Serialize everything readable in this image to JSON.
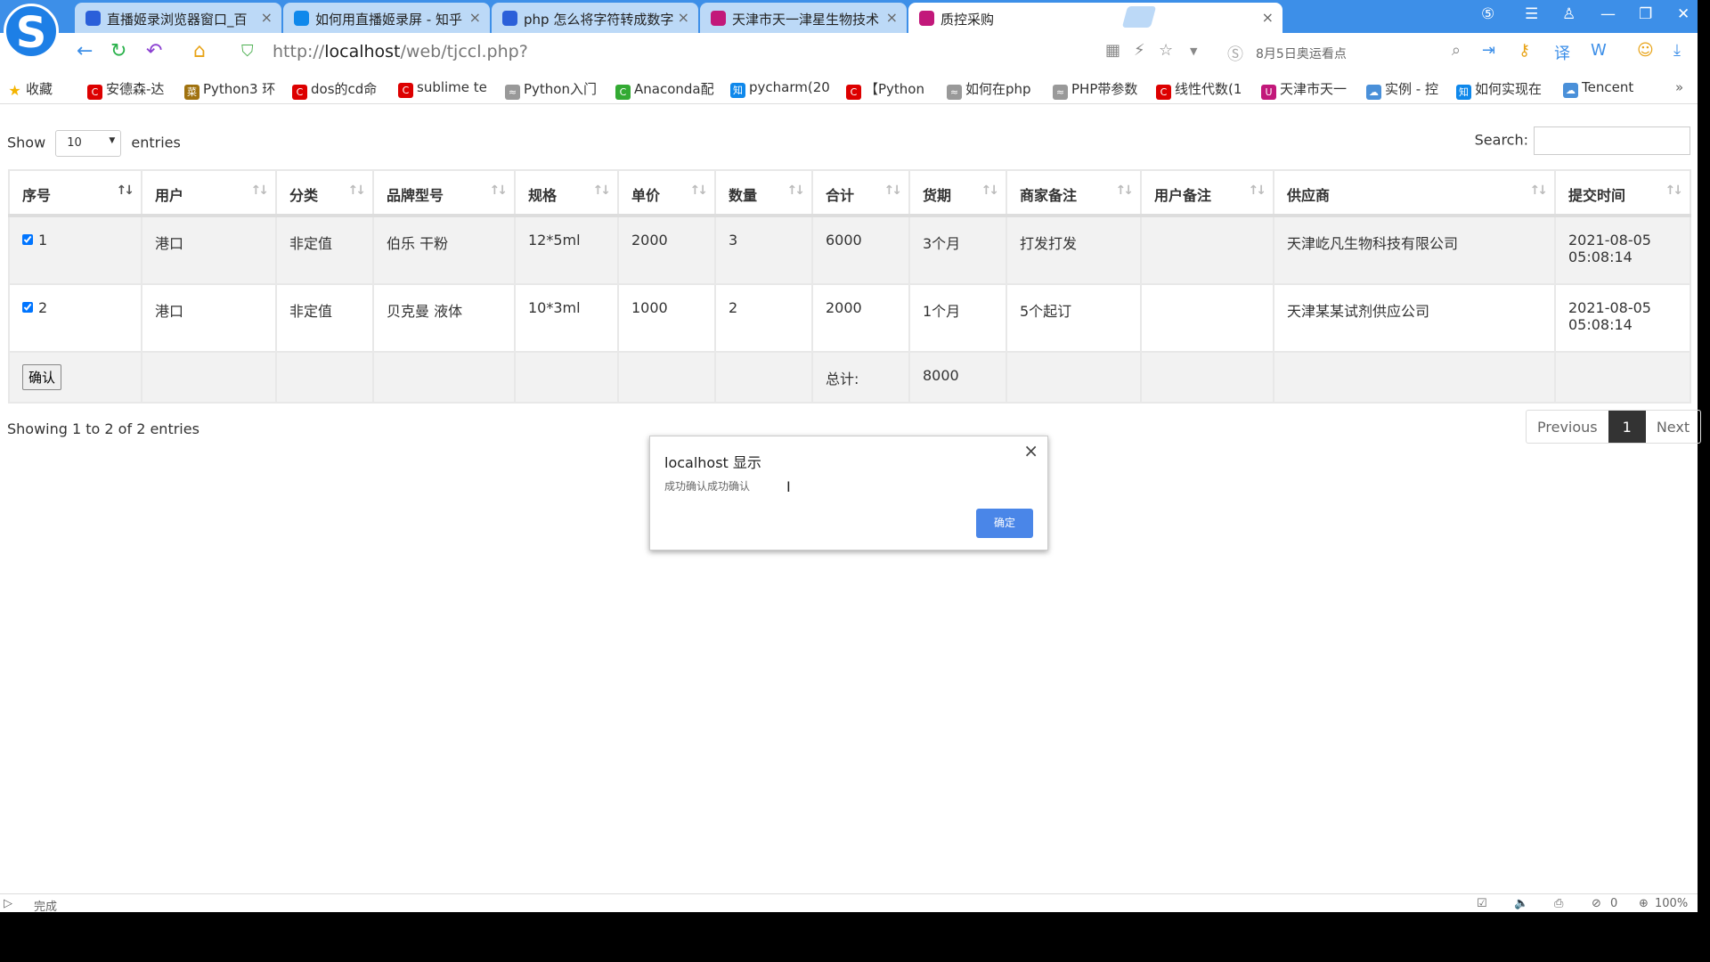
{
  "browser": {
    "tabs": [
      {
        "label": "直播姬录浏览器窗口_百",
        "icon": "baidu-paw-icon",
        "color": "#2b5fd9"
      },
      {
        "label": "如何用直播姬录屏 - 知乎",
        "icon": "zhihu-icon",
        "color": "#0f88eb"
      },
      {
        "label": "php 怎么将字符转成数字",
        "icon": "baidu-paw-icon",
        "color": "#2b5fd9"
      },
      {
        "label": "天津市天一津星生物技术",
        "icon": "site-icon",
        "color": "#c2187a"
      },
      {
        "label": "质控采购",
        "icon": "site-icon",
        "color": "#c2187a",
        "active": true
      }
    ],
    "url_prefix": "http://",
    "url_host": "localhost",
    "url_path": "/web/tjccl.php?",
    "search_hint": "8月5日奥运看点",
    "bookmarks": [
      {
        "label": "收藏",
        "color": "#f4b400",
        "glyph": "★"
      },
      {
        "label": "安德森-达",
        "color": "#d00",
        "glyph": "C"
      },
      {
        "label": "Python3 环",
        "color": "#a0720f",
        "glyph": "菜"
      },
      {
        "label": "dos的cd命",
        "color": "#d00",
        "glyph": "C"
      },
      {
        "label": "sublime te",
        "color": "#d00",
        "glyph": "C"
      },
      {
        "label": "Python入门",
        "color": "#999",
        "glyph": "≈"
      },
      {
        "label": "Anaconda配",
        "color": "#3a3",
        "glyph": "C"
      },
      {
        "label": "pycharm(20",
        "color": "#0f88eb",
        "glyph": "知"
      },
      {
        "label": "【Python",
        "color": "#d00",
        "glyph": "C"
      },
      {
        "label": "如何在php",
        "color": "#999",
        "glyph": "≈"
      },
      {
        "label": "PHP带参数",
        "color": "#999",
        "glyph": "≈"
      },
      {
        "label": "线性代数(1",
        "color": "#d00",
        "glyph": "C"
      },
      {
        "label": "天津市天一",
        "color": "#c2187a",
        "glyph": "U"
      },
      {
        "label": "实例 - 控",
        "color": "#4a90d9",
        "glyph": "☁"
      },
      {
        "label": "如何实现在",
        "color": "#0f88eb",
        "glyph": "知"
      },
      {
        "label": "Tencent",
        "color": "#4a90d9",
        "glyph": "☁"
      }
    ],
    "status_left": "完成",
    "status_count": "0",
    "zoom": "100%"
  },
  "page": {
    "show_label": "Show",
    "entries_label": "entries",
    "page_length": "10",
    "search_label": "Search:",
    "search_value": "",
    "columns": [
      "序号",
      "用户",
      "分类",
      "品牌型号",
      "规格",
      "单价",
      "数量",
      "合计",
      "货期",
      "商家备注",
      "用户备注",
      "供应商",
      "提交时间"
    ],
    "rows": [
      {
        "checked": true,
        "cells": [
          "1",
          "港口",
          "非定值",
          "伯乐 干粉",
          "12*5ml",
          "2000",
          "3",
          "6000",
          "3个月",
          "打发打发",
          "",
          "天津屹凡生物科技有限公司",
          "2021-08-05 05:08:14"
        ]
      },
      {
        "checked": true,
        "cells": [
          "2",
          "港口",
          "非定值",
          "贝克曼 液体",
          "10*3ml",
          "1000",
          "2",
          "2000",
          "1个月",
          "5个起订",
          "",
          "天津某某试剂供应公司",
          "2021-08-05 05:08:14"
        ]
      }
    ],
    "confirm_button": "确认",
    "total_label": "总计:",
    "total_value": "8000",
    "info": "Showing 1 to 2 of 2 entries",
    "previous": "Previous",
    "current_page": "1",
    "next": "Next"
  },
  "dialog": {
    "title": "localhost 显示",
    "message": "成功确认成功确认",
    "ok": "确定"
  }
}
